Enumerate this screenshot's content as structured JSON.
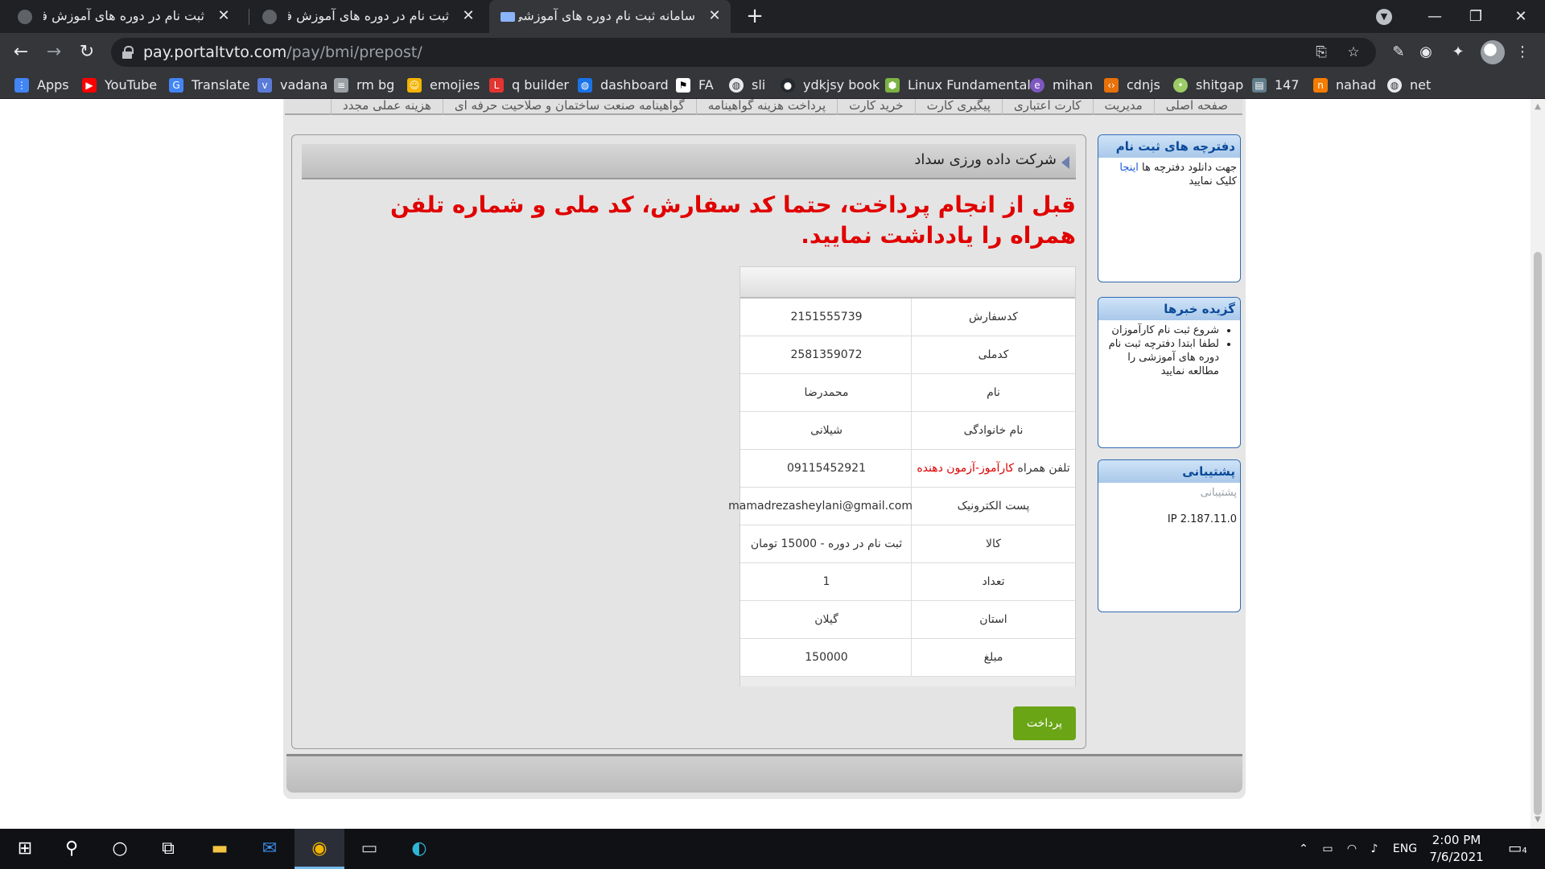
{
  "browser": {
    "tabs": [
      {
        "title": "ثبت نام در دوره های آموزش فنی و",
        "active": false
      },
      {
        "title": "ثبت نام در دوره های آموزش فنی و",
        "active": false
      },
      {
        "title": "سامانه ثبت نام دوره های آموزشی",
        "active": true
      }
    ],
    "url_host": "pay.portaltvto.com",
    "url_path": "/pay/bmi/prepost/",
    "bookmarks": [
      {
        "label": "Apps",
        "icon": "apps-grid-icon",
        "color": "#4285f4"
      },
      {
        "label": "YouTube",
        "icon": "youtube-icon",
        "color": "#ff0000"
      },
      {
        "label": "Translate",
        "icon": "translate-icon",
        "color": "#4285f4"
      },
      {
        "label": "vadana",
        "icon": "vadana-icon",
        "color": "#5a7bd8"
      },
      {
        "label": "rm bg",
        "icon": "layers-icon",
        "color": "#9aa0a6"
      },
      {
        "label": "emojies",
        "icon": "emoji-icon",
        "color": "#f4b400"
      },
      {
        "label": "q builder",
        "icon": "laravel-icon",
        "color": "#e3342f"
      },
      {
        "label": "dashboard",
        "icon": "globe-icon",
        "color": "#1a73e8"
      },
      {
        "label": "FA",
        "icon": "flag-icon",
        "color": "#ffffff"
      },
      {
        "label": "sli",
        "icon": "globe-icon",
        "color": "#e8eaed"
      },
      {
        "label": "ydkjsy book",
        "icon": "github-icon",
        "color": "#24292e"
      },
      {
        "label": "Linux Fundamentals",
        "icon": "cube-icon",
        "color": "#7cb342"
      },
      {
        "label": "mihan",
        "icon": "mihan-icon",
        "color": "#7e57c2"
      },
      {
        "label": "cdnjs",
        "icon": "code-icon",
        "color": "#e8710a"
      },
      {
        "label": "shitgap",
        "icon": "bulb-icon",
        "color": "#9ccc65"
      },
      {
        "label": "147",
        "icon": "page-icon",
        "color": "#607d8b"
      },
      {
        "label": "nahad",
        "icon": "nahad-icon",
        "color": "#f57c00"
      },
      {
        "label": "net",
        "icon": "globe-icon",
        "color": "#e8eaed"
      }
    ]
  },
  "site": {
    "menu": [
      "صفحه اصلی",
      "مدیریت",
      "کارت اعتباری",
      "پیگیری کارت",
      "خرید کارت",
      "پرداخت هزینه گواهینامه",
      "گواهینامه صنعت ساختمان و صلاحیت حرفه ای",
      "هزینه عملی مجدد"
    ],
    "breadcrumb": "شرکت داده ورزی سداد",
    "warning": "قبل از انجام پرداخت، حتما کد سفارش، کد ملی و شماره تلفن همراه را یادداشت نمایید.",
    "rows": [
      {
        "label": "کدسفارش",
        "value": "2151555739"
      },
      {
        "label": "کدملی",
        "value": "2581359072"
      },
      {
        "label": "نام",
        "value": "محمدرضا"
      },
      {
        "label": "نام خانوادگی",
        "value": "شیلانی"
      },
      {
        "label": "تلفن همراه",
        "label_note": "کارآموز-آزمون دهنده",
        "value": "09115452921"
      },
      {
        "label": "پست الکترونیک",
        "value": "mamadrezasheylani@gmail.com"
      },
      {
        "label": "کالا",
        "value": "ثبت نام در دوره - 15000 تومان"
      },
      {
        "label": "تعداد",
        "value": "1"
      },
      {
        "label": "استان",
        "value": "گیلان"
      },
      {
        "label": "مبلغ",
        "value": "150000"
      }
    ],
    "pay_button": "پرداخت",
    "sidebar": {
      "booklets": {
        "title": "دفترچه های ثبت نام",
        "text_before": "جهت دانلود دفترچه ها",
        "link": "اینجا",
        "text_after": "کلیک نمایید"
      },
      "news": {
        "title": "گزیده خبرها",
        "items": [
          "شروع ثبت نام کارآموزان",
          "لطفا ابتدا دفترچه ثبت نام دوره های آموزشی را مطالعه نمایید"
        ]
      },
      "support": {
        "title": "پشتیبانی",
        "link": "پشتیبانی",
        "ip": "IP 2.187.11.0"
      }
    },
    "colors": {
      "warning": "#e00000",
      "pay_button": "#6aa516",
      "sidebar_header": "#0b4a9a"
    }
  },
  "taskbar": {
    "lang": "ENG",
    "time": "2:00 PM",
    "date": "7/6/2021",
    "notifications": "4"
  }
}
